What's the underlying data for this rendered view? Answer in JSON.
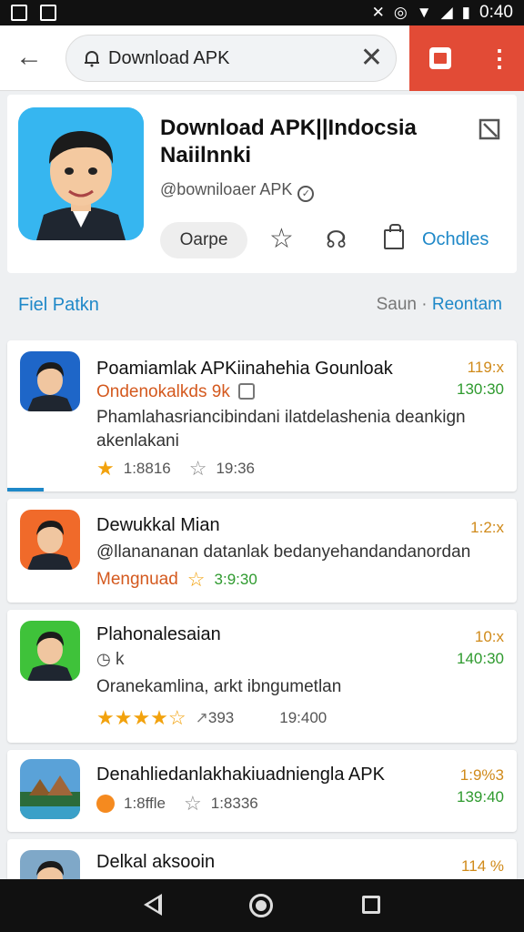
{
  "status": {
    "time": "0:40",
    "icons": [
      "photo-icon",
      "image-icon",
      "no-sound-icon",
      "alarm-icon",
      "wifi-icon",
      "signal-icon",
      "battery-icon"
    ]
  },
  "search": {
    "query": "Download APK"
  },
  "header": {
    "title_line1": "Download APK||Indocsia",
    "title_line2": "Naiilnnki",
    "developer": "@bowniloaer APK",
    "open_label": "Oarpe",
    "details_label": "Ochdles"
  },
  "section": {
    "left": "Fiel Patkn",
    "right_muted": "Saun ·",
    "right_accent": "Reontam"
  },
  "items": [
    {
      "title": "Poamiamlak APKiinahehia Gounloak",
      "subtitle": "Ondenokalkds 9k",
      "desc": "Phamlahasriancibindani ilatdelashenia deankign akenlakani",
      "meta1": "119:x",
      "meta2": "130:30",
      "rating": "1:8816",
      "downloads": "19:36"
    },
    {
      "title": "Dewukkal Mian",
      "desc": "@llanananan datanlak bedanyehandandanordan",
      "subtitle": "Mengnuad",
      "meta1": "1:2:x",
      "meta2": "3:9:30"
    },
    {
      "title": "Plahonalesaian",
      "subtitle": "k",
      "desc": "Oranekamlina, arkt ibngumetlan",
      "meta1": "10:x",
      "meta2": "140:30",
      "rating": "393",
      "downloads": "19:400"
    },
    {
      "title": "Denahliedanlakhakiuadniengla APK",
      "meta1": "1:9%3",
      "meta2": "139:40",
      "rating": "1:8ffle",
      "downloads": "1:8336"
    },
    {
      "title": "Delkal aksooin",
      "meta1": "114 %"
    }
  ],
  "colors": {
    "accent_blue": "#1e88c8",
    "brand_red": "#e24b36",
    "meta_orange": "#d08a1a",
    "meta_green": "#2e9a2e",
    "star": "#f2a20d"
  }
}
